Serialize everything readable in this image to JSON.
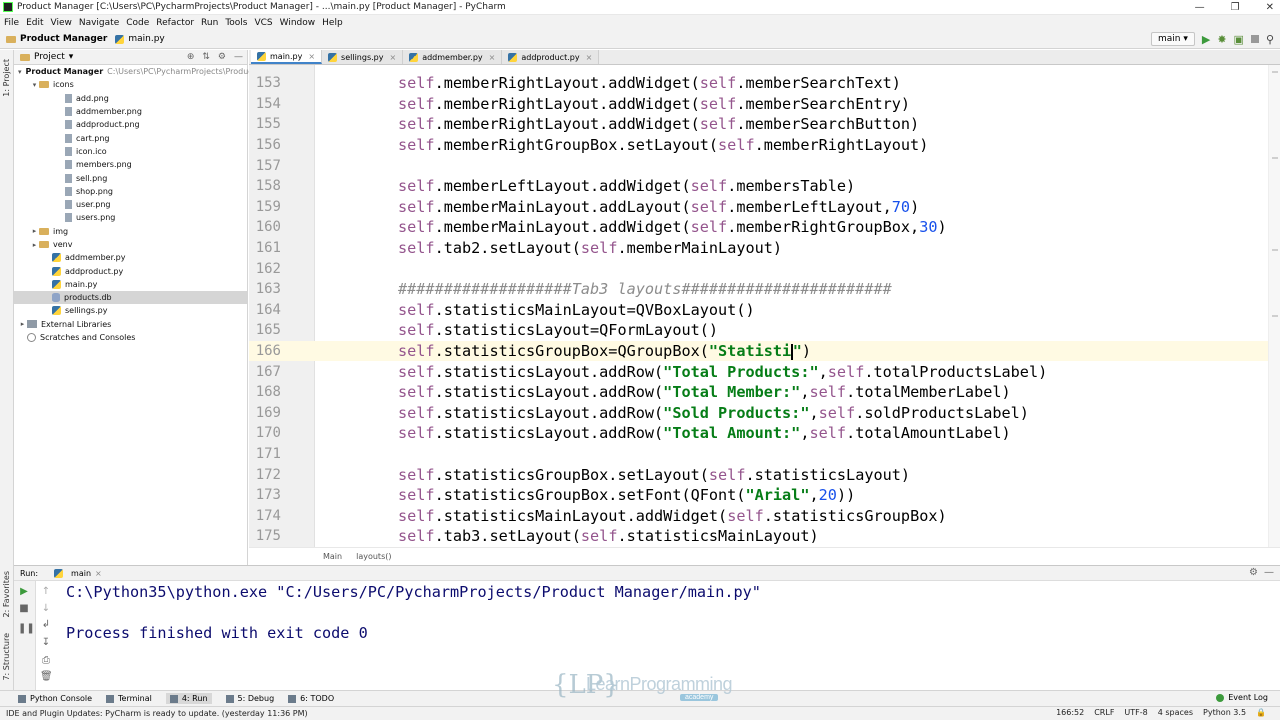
{
  "window": {
    "title": "Product Manager [C:\\Users\\PC\\PycharmProjects\\Product Manager] - ...\\main.py [Product Manager] - PyCharm"
  },
  "menu": [
    "File",
    "Edit",
    "View",
    "Navigate",
    "Code",
    "Refactor",
    "Run",
    "Tools",
    "VCS",
    "Window",
    "Help"
  ],
  "breadcrumb": {
    "project": "Product Manager",
    "file": "main.py"
  },
  "toolbar": {
    "run_config": "main"
  },
  "left_strip": {
    "project_tab": "1: Project",
    "favorites_tab": "2: Favorites",
    "structure_tab": "7: Structure"
  },
  "project_panel": {
    "header": "Project",
    "root": {
      "name": "Product Manager",
      "path": "C:\\Users\\PC\\PycharmProjects\\Product"
    },
    "icons_folder": "icons",
    "icon_files": [
      "add.png",
      "addmember.png",
      "addproduct.png",
      "cart.png",
      "icon.ico",
      "members.png",
      "sell.png",
      "shop.png",
      "user.png",
      "users.png"
    ],
    "folders": [
      "img",
      "venv"
    ],
    "files": [
      "addmember.py",
      "addproduct.py",
      "main.py",
      "products.db",
      "sellings.py"
    ],
    "selected": "products.db",
    "external_libraries": "External Libraries",
    "scratches": "Scratches and Consoles"
  },
  "editor_tabs": [
    "main.py",
    "sellings.py",
    "addmember.py",
    "addproduct.py"
  ],
  "editor": {
    "current_line": "166",
    "lines": [
      {
        "n": "153",
        "code": "self.memberRightLayout.addWidget(self.memberSearchText)"
      },
      {
        "n": "154",
        "code": "self.memberRightLayout.addWidget(self.memberSearchEntry)"
      },
      {
        "n": "155",
        "code": "self.memberRightLayout.addWidget(self.memberSearchButton)"
      },
      {
        "n": "156",
        "code": "self.memberRightGroupBox.setLayout(self.memberRightLayout)"
      },
      {
        "n": "157",
        "code": ""
      },
      {
        "n": "158",
        "code": "self.memberLeftLayout.addWidget(self.membersTable)"
      },
      {
        "n": "159",
        "code": "self.memberMainLayout.addLayout(self.memberLeftLayout,70)"
      },
      {
        "n": "160",
        "code": "self.memberMainLayout.addWidget(self.memberRightGroupBox,30)"
      },
      {
        "n": "161",
        "code": "self.tab2.setLayout(self.memberMainLayout)"
      },
      {
        "n": "162",
        "code": ""
      },
      {
        "n": "163",
        "code": "###################Tab3 layouts#######################"
      },
      {
        "n": "164",
        "code": "self.statisticsMainLayout=QVBoxLayout()"
      },
      {
        "n": "165",
        "code": "self.statisticsLayout=QFormLayout()"
      },
      {
        "n": "166",
        "code": "self.statisticsGroupBox=QGroupBox(\"Statisti\")"
      },
      {
        "n": "167",
        "code": "self.statisticsLayout.addRow(\"Total Products:\",self.totalProductsLabel)"
      },
      {
        "n": "168",
        "code": "self.statisticsLayout.addRow(\"Total Member:\",self.totalMemberLabel)"
      },
      {
        "n": "169",
        "code": "self.statisticsLayout.addRow(\"Sold Products:\",self.soldProductsLabel)"
      },
      {
        "n": "170",
        "code": "self.statisticsLayout.addRow(\"Total Amount:\",self.totalAmountLabel)"
      },
      {
        "n": "171",
        "code": ""
      },
      {
        "n": "172",
        "code": "self.statisticsGroupBox.setLayout(self.statisticsLayout)"
      },
      {
        "n": "173",
        "code": "self.statisticsGroupBox.setFont(QFont(\"Arial\",20))"
      },
      {
        "n": "174",
        "code": "self.statisticsMainLayout.addWidget(self.statisticsGroupBox)"
      },
      {
        "n": "175",
        "code": "self.tab3.setLayout(self.statisticsMainLayout)"
      }
    ],
    "crumbs": [
      "Main",
      "layouts()"
    ]
  },
  "run_panel": {
    "label": "Run:",
    "config": "main",
    "output": [
      "C:\\Python35\\python.exe \"C:/Users/PC/PycharmProjects/Product Manager/main.py\"",
      "",
      "Process finished with exit code 0"
    ]
  },
  "bottom_tools": [
    "Python Console",
    "Terminal",
    "4: Run",
    "5: Debug",
    "6: TODO"
  ],
  "bottom_active": "4: Run",
  "event_log": "Event Log",
  "status": {
    "message": "IDE and Plugin Updates: PyCharm is ready to update. (yesterday 11:36 PM)",
    "position": "166:52",
    "line_sep": "CRLF",
    "encoding": "UTF-8",
    "indent": "4 spaces",
    "interpreter": "Python 3.5"
  },
  "watermark": {
    "brand": "LearnProgramming",
    "sub": "academy"
  },
  "colors": {
    "keyword": "#94558d",
    "string": "#067d17",
    "number": "#1750eb",
    "comment": "#8c8c8c",
    "current_line_bg": "#fffae3"
  }
}
